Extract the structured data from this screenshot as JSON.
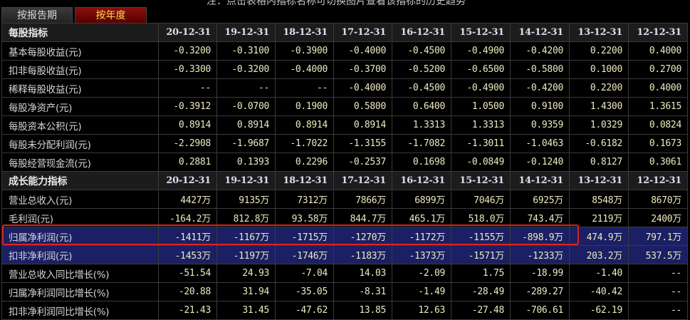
{
  "note": "注：点击表格内指标名称可切换图片查看该指标的历史趋势",
  "tabs": [
    {
      "label": "按报告期",
      "active": false
    },
    {
      "label": "按年度",
      "active": true
    }
  ],
  "columns": [
    "20-12-31",
    "19-12-31",
    "18-12-31",
    "17-12-31",
    "16-12-31",
    "15-12-31",
    "14-12-31",
    "13-12-31",
    "12-12-31"
  ],
  "sections": [
    {
      "title": "每股指标",
      "rows": [
        {
          "label": "基本每股收益(元)",
          "values": [
            "-0.3200",
            "-0.3100",
            "-0.3900",
            "-0.4000",
            "-0.4500",
            "-0.4900",
            "-0.4200",
            "0.2200",
            "0.4000"
          ]
        },
        {
          "label": "扣非每股收益(元)",
          "values": [
            "-0.3300",
            "-0.3200",
            "-0.4000",
            "-0.3700",
            "-0.5200",
            "-0.6500",
            "-0.5800",
            "0.1000",
            "0.2700"
          ]
        },
        {
          "label": "稀释每股收益(元)",
          "values": [
            "--",
            "--",
            "--",
            "-0.4000",
            "-0.4500",
            "-0.4900",
            "-0.4200",
            "0.2200",
            "0.4000"
          ]
        },
        {
          "label": "每股净资产(元)",
          "values": [
            "-0.3912",
            "-0.0700",
            "0.1900",
            "0.5800",
            "0.6400",
            "1.0500",
            "0.9100",
            "1.4300",
            "1.3615"
          ]
        },
        {
          "label": "每股资本公积(元)",
          "values": [
            "0.8914",
            "0.8914",
            "0.8914",
            "0.8914",
            "1.3313",
            "1.3313",
            "0.9359",
            "1.0329",
            "0.0824"
          ]
        },
        {
          "label": "每股未分配利润(元)",
          "values": [
            "-2.2908",
            "-1.9687",
            "-1.7022",
            "-1.3155",
            "-1.7082",
            "-1.3011",
            "-1.0463",
            "-0.6182",
            "0.1673"
          ]
        },
        {
          "label": "每股经营现金流(元)",
          "values": [
            "0.2881",
            "0.1393",
            "0.2296",
            "-0.2537",
            "0.1698",
            "-0.0849",
            "-0.1240",
            "0.8127",
            "0.3061"
          ]
        }
      ]
    },
    {
      "title": "成长能力指标",
      "rows": [
        {
          "label": "营业总收入(元)",
          "values": [
            "4427万",
            "9135万",
            "7312万",
            "7866万",
            "6899万",
            "7046万",
            "6925万",
            "8548万",
            "8670万"
          ]
        },
        {
          "label": "毛利润(元)",
          "values": [
            "-164.2万",
            "812.8万",
            "93.58万",
            "844.7万",
            "465.1万",
            "518.0万",
            "743.4万",
            "2119万",
            "2400万"
          ]
        },
        {
          "label": "归属净利润(元)",
          "selected": true,
          "values": [
            "-1411万",
            "-1167万",
            "-1715万",
            "-1270万",
            "-1172万",
            "-1155万",
            "-898.9万",
            "474.9万",
            "797.1万"
          ]
        },
        {
          "label": "扣非净利润(元)",
          "selected": true,
          "values": [
            "-1453万",
            "-1197万",
            "-1746万",
            "-1183万",
            "-1373万",
            "-1571万",
            "-1233万",
            "203.2万",
            "537.5万"
          ]
        },
        {
          "label": "营业总收入同比增长(%)",
          "values": [
            "-51.54",
            "24.93",
            "-7.04",
            "14.03",
            "-2.09",
            "1.75",
            "-18.99",
            "-1.40",
            "--"
          ]
        },
        {
          "label": "归属净利润同比增长(%)",
          "values": [
            "-20.88",
            "31.94",
            "-35.05",
            "-8.31",
            "-1.49",
            "-28.49",
            "-289.27",
            "-40.42",
            "--"
          ]
        },
        {
          "label": "扣非净利润同比增长(%)",
          "values": [
            "-21.43",
            "31.45",
            "-47.62",
            "13.85",
            "12.63",
            "-27.48",
            "-706.61",
            "-62.19",
            "--"
          ]
        }
      ]
    }
  ],
  "colors": {
    "value": "#ede9c0",
    "selected_row": "#1b1f63",
    "highlight_box": "#e02020",
    "active_tab": "#8a0f0f"
  }
}
